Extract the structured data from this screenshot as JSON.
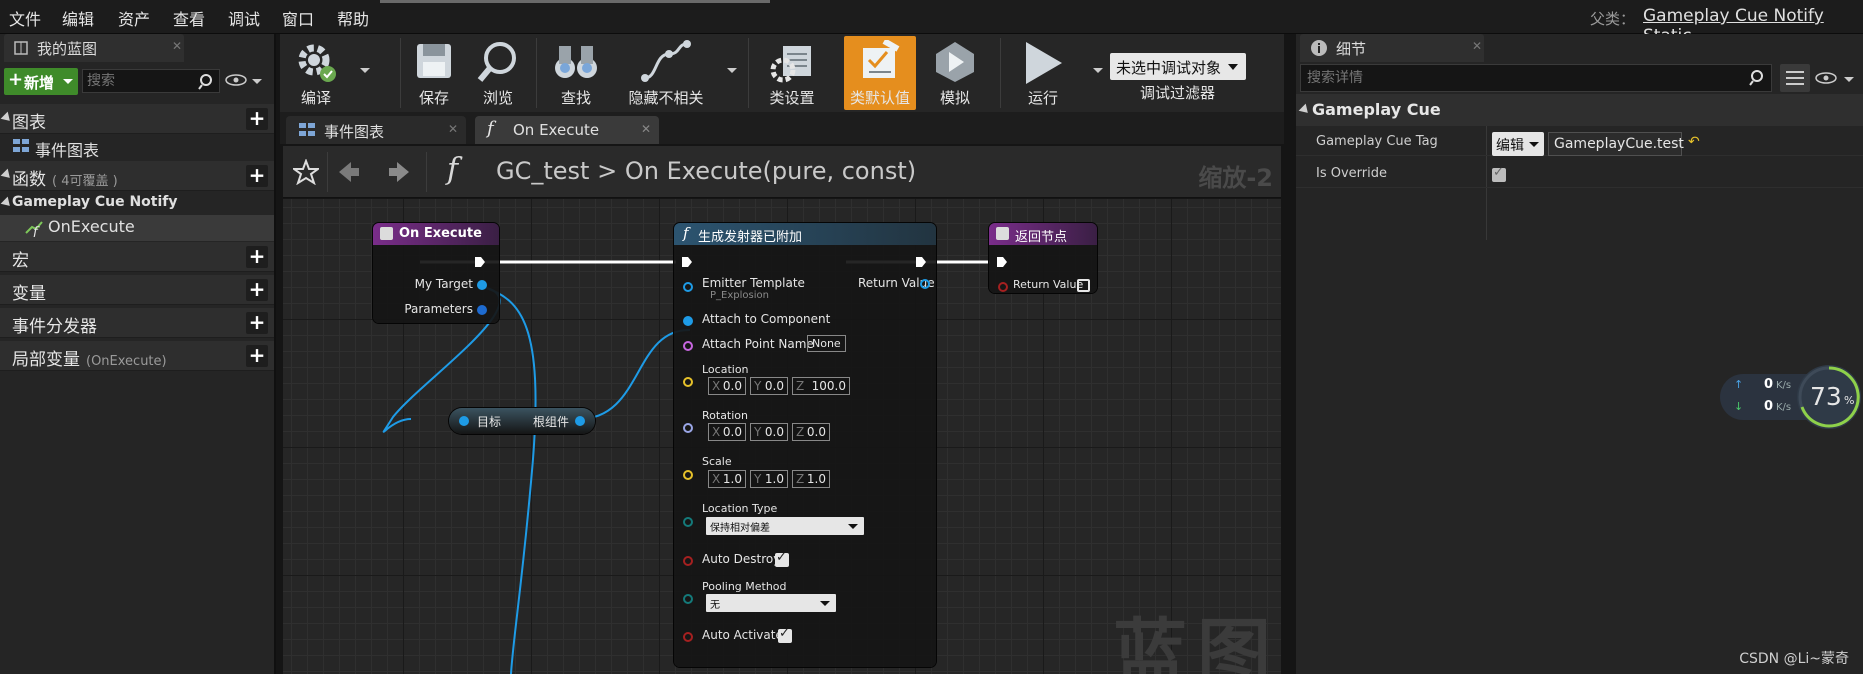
{
  "menu": {
    "items": [
      "文件",
      "编辑",
      "资产",
      "查看",
      "调试",
      "窗口",
      "帮助"
    ],
    "parent_class_label": "父类：",
    "parent_class_value": "Gameplay Cue Notify Static"
  },
  "my_blueprint": {
    "tab_title": "我的蓝图",
    "add_new_label": "新增",
    "search_placeholder": "搜索",
    "sections": {
      "graphs": "图表",
      "event_graph_item": "事件图表",
      "functions": "函数",
      "functions_hint": "( 4可覆盖 )",
      "gameplay_cue_notify": "Gameplay Cue Notify",
      "on_execute_item": "OnExecute",
      "macros": "宏",
      "variables": "变量",
      "event_dispatchers": "事件分发器",
      "local_variables": "局部变量",
      "local_variables_hint": "(OnExecute)"
    }
  },
  "toolbar": {
    "compile": "编译",
    "save": "保存",
    "browse": "浏览",
    "find": "查找",
    "hide_unrelated": "隐藏不相关",
    "class_settings": "类设置",
    "class_defaults": "类默认值",
    "simulate": "模拟",
    "run": "运行",
    "debug_object": "未选中调试对象",
    "debug_filter": "调试过滤器"
  },
  "graph_tabs": {
    "event_graph": "事件图表",
    "on_execute": "On Execute"
  },
  "breadcrumb": {
    "blueprint": "GC_test",
    "separator": ">",
    "function": "On Execute(pure, const)",
    "zoom": "缩放-2"
  },
  "nodes": {
    "entry": {
      "title": "On Execute",
      "pin_target": "My Target",
      "pin_params": "Parameters"
    },
    "get_root": {
      "pin_target": "目标",
      "pin_root": "根组件"
    },
    "spawn": {
      "title": "生成发射器已附加",
      "emitter_template": "Emitter Template",
      "emitter_value": "P_Explosion",
      "return_value": "Return Value",
      "attach_to_component": "Attach to Component",
      "attach_point_name": "Attach Point Name",
      "attach_point_value": "None",
      "location": "Location",
      "location_xyz": [
        "0.0",
        "0.0",
        "100.0"
      ],
      "rotation": "Rotation",
      "rotation_xyz": [
        "0.0",
        "0.0",
        "0.0"
      ],
      "scale": "Scale",
      "scale_xyz": [
        "1.0",
        "1.0",
        "1.0"
      ],
      "axis_labels": [
        "X",
        "Y",
        "Z"
      ],
      "location_type": "Location Type",
      "location_type_value": "保持相对偏差",
      "auto_destroy": "Auto Destroy",
      "pooling_method": "Pooling Method",
      "pooling_value": "无",
      "auto_activate": "Auto Activate"
    },
    "return": {
      "title": "返回节点",
      "pin_return": "Return Value"
    }
  },
  "watermark": "蓝图",
  "details": {
    "tab_title": "细节",
    "search_placeholder": "搜索详情",
    "category": "Gameplay Cue",
    "tag_label": "Gameplay Cue Tag",
    "tag_edit": "编辑",
    "tag_value": "GameplayCue.test",
    "override_label": "Is Override"
  },
  "net_monitor": {
    "up": "0",
    "down": "0",
    "unit": "K/s",
    "percent": "73",
    "percent_unit": "%"
  },
  "credit": "CSDN @Li~蒙奇",
  "colors": {
    "accent": "#e58e1e",
    "add_green": "#3f8b2a",
    "pin_blue": "#1e9be6",
    "func_header": "#2c5470",
    "entry_header": "#7a2d8a"
  }
}
